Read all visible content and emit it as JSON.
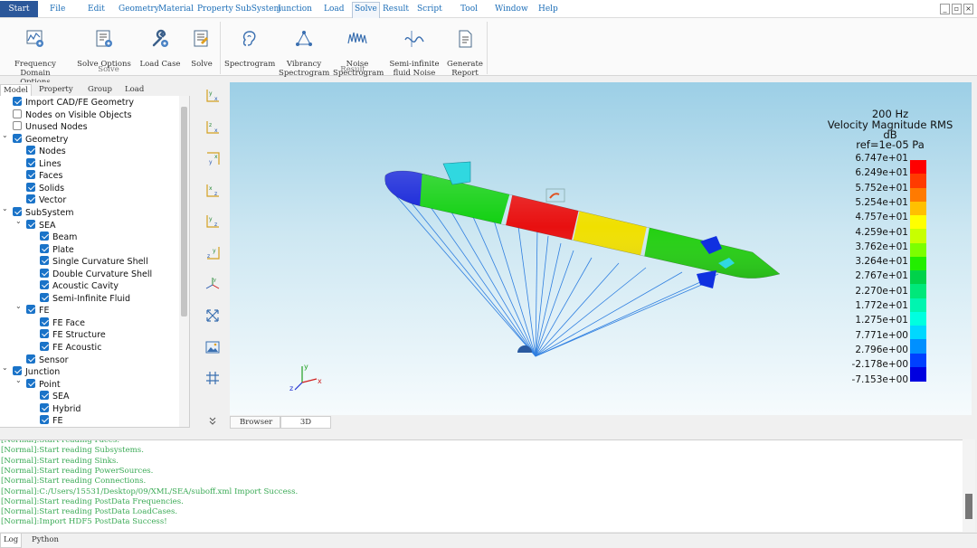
{
  "menu": {
    "start": "Start",
    "items": [
      "File",
      "Edit",
      "Geometry",
      "Material",
      "Property",
      "SubSystem",
      "Junction",
      "Load",
      "Solve",
      "Result",
      "Script",
      "Tool",
      "Window",
      "Help"
    ],
    "active": "Solve"
  },
  "window_controls": [
    "_",
    "▫",
    "×"
  ],
  "ribbon": {
    "solve_group": {
      "label": "Solve",
      "buttons": [
        "Frequency Domain\nOptions",
        "Solve Options",
        "Load Case",
        "Solve"
      ]
    },
    "result_group": {
      "label": "Result",
      "buttons": [
        "Spectrogram",
        "Vibrancy\nSpectrogram",
        "Noise\nSpectrogram",
        "Semi-infinite\nfluid Noise",
        "Generate\nReport"
      ]
    }
  },
  "left_tabs": [
    "Model",
    "Property",
    "Group",
    "Load"
  ],
  "tree": [
    {
      "label": "Import CAD/FE Geometry",
      "checked": true,
      "level": 1,
      "caret": false
    },
    {
      "label": "Nodes on Visible Objects",
      "checked": false,
      "level": 1,
      "caret": false
    },
    {
      "label": "Unused Nodes",
      "checked": false,
      "level": 1,
      "caret": false
    },
    {
      "label": "Geometry",
      "checked": true,
      "level": 1,
      "caret": true
    },
    {
      "label": "Nodes",
      "checked": true,
      "level": 2,
      "caret": false
    },
    {
      "label": "Lines",
      "checked": true,
      "level": 2,
      "caret": false
    },
    {
      "label": "Faces",
      "checked": true,
      "level": 2,
      "caret": false
    },
    {
      "label": "Solids",
      "checked": true,
      "level": 2,
      "caret": false
    },
    {
      "label": "Vector",
      "checked": true,
      "level": 2,
      "caret": false
    },
    {
      "label": "SubSystem",
      "checked": true,
      "level": 1,
      "caret": true
    },
    {
      "label": "SEA",
      "checked": true,
      "level": 2,
      "caret": true
    },
    {
      "label": "Beam",
      "checked": true,
      "level": 3,
      "caret": false
    },
    {
      "label": "Plate",
      "checked": true,
      "level": 3,
      "caret": false
    },
    {
      "label": "Single Curvature Shell",
      "checked": true,
      "level": 3,
      "caret": false
    },
    {
      "label": "Double Curvature Shell",
      "checked": true,
      "level": 3,
      "caret": false
    },
    {
      "label": "Acoustic Cavity",
      "checked": true,
      "level": 3,
      "caret": false
    },
    {
      "label": "Semi-Infinite Fluid",
      "checked": true,
      "level": 3,
      "caret": false
    },
    {
      "label": "FE",
      "checked": true,
      "level": 2,
      "caret": true
    },
    {
      "label": "FE Face",
      "checked": true,
      "level": 3,
      "caret": false
    },
    {
      "label": "FE Structure",
      "checked": true,
      "level": 3,
      "caret": false
    },
    {
      "label": "FE Acoustic",
      "checked": true,
      "level": 3,
      "caret": false
    },
    {
      "label": "Sensor",
      "checked": true,
      "level": 2,
      "caret": false
    },
    {
      "label": "Junction",
      "checked": true,
      "level": 1,
      "caret": true
    },
    {
      "label": "Point",
      "checked": true,
      "level": 2,
      "caret": true
    },
    {
      "label": "SEA",
      "checked": true,
      "level": 3,
      "caret": false
    },
    {
      "label": "Hybrid",
      "checked": true,
      "level": 3,
      "caret": false
    },
    {
      "label": "FE",
      "checked": true,
      "level": 3,
      "caret": false
    }
  ],
  "side_toolbar_icons": [
    "view-xy-icon",
    "view-xz-icon",
    "view-yx-icon",
    "view-zx-icon",
    "view-yz-icon",
    "view-zy-icon",
    "view-iso-icon",
    "fit-view-icon",
    "screenshot-icon",
    "grid-icon",
    "expand-more-icon"
  ],
  "view_tabs": [
    "Browser",
    "3D"
  ],
  "legend": {
    "title_lines": [
      "200 Hz",
      "Velocity Magnitude RMS",
      "dB",
      "ref=1e-05 Pa"
    ],
    "values": [
      "6.747e+01",
      "6.249e+01",
      "5.752e+01",
      "5.254e+01",
      "4.757e+01",
      "4.259e+01",
      "3.762e+01",
      "3.264e+01",
      "2.767e+01",
      "2.270e+01",
      "1.772e+01",
      "1.275e+01",
      "7.771e+00",
      "2.796e+00",
      "-2.178e+00",
      "-7.153e+00"
    ],
    "colors": [
      "#ff0000",
      "#ff3a00",
      "#ff7a00",
      "#ffc000",
      "#ffff00",
      "#c8ff00",
      "#7cff00",
      "#22ee00",
      "#00d24a",
      "#00e87a",
      "#00f5b0",
      "#00ffe0",
      "#00d8ff",
      "#0090ff",
      "#0040ff",
      "#0000e0"
    ]
  },
  "axis_labels": {
    "x": "x",
    "y": "y",
    "z": "z"
  },
  "log_lines": [
    "[Normal]:Start reading Faces.",
    "[Normal]:Start reading Subsystems.",
    "[Normal]:Start reading Sinks.",
    "[Normal]:Start reading PowerSources.",
    "[Normal]:Start reading Connections.",
    "[Normal]:C:/Users/15531/Desktop/09/XML/SEA/suboff.xml Import Success.",
    "[Normal]:Start reading PostData Frequencies.",
    "[Normal]:Start reading PostData LoadCases.",
    "[Normal]:Import HDF5 PostData Success!"
  ],
  "bottom_tabs": [
    "Log",
    "Python"
  ]
}
